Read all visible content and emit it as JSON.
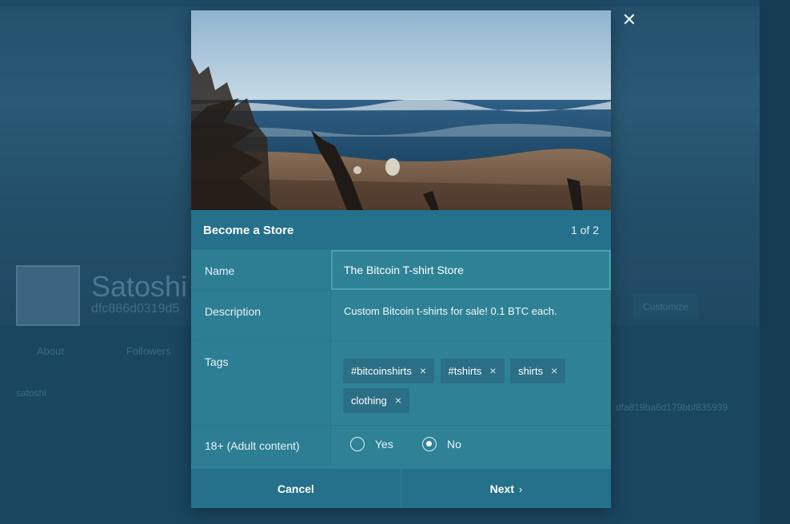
{
  "background": {
    "profile_name": "Satoshi",
    "profile_guid": "dfc886d0319d5",
    "tab_about": "About",
    "tab_followers": "Followers",
    "side_text": "satoshi",
    "guid_fragment": "dfa819ba6d179bbf835939",
    "button_customize": "Customize"
  },
  "modal": {
    "close_icon": "close-icon",
    "title": "Become a Store",
    "step": "1 of 2",
    "fields": {
      "name_label": "Name",
      "name_value": "The Bitcoin T-shirt Store",
      "description_label": "Description",
      "description_value": "Custom Bitcoin t-shirts for sale! 0.1 BTC each.",
      "tags_label": "Tags",
      "tags": [
        "#bitcoinshirts",
        "#tshirts",
        "shirts",
        "clothing"
      ],
      "tag_remove_glyph": "×",
      "adult_label": "18+ (Adult content)",
      "adult_options": [
        {
          "label": "Yes",
          "checked": false
        },
        {
          "label": "No",
          "checked": true
        }
      ]
    },
    "footer": {
      "cancel_label": "Cancel",
      "next_label": "Next",
      "next_chevron": "›"
    }
  },
  "colors": {
    "modal_bg": "#2f8296",
    "header_bg": "#25708a",
    "tag_bg": "#2a6f85",
    "page_bg": "#163d55"
  }
}
